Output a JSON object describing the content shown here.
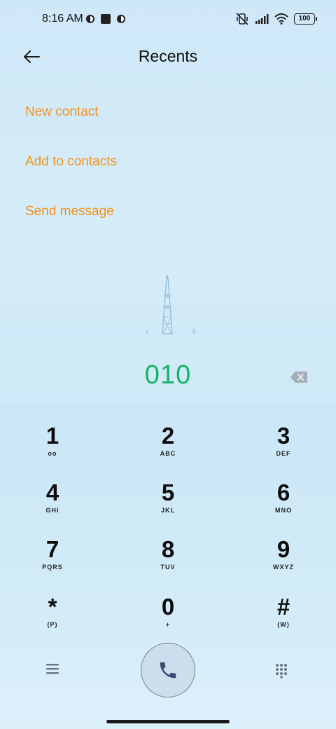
{
  "status_bar": {
    "time": "8:16 AM",
    "battery": "100"
  },
  "header": {
    "title": "Recents"
  },
  "menu": {
    "new_contact": "New contact",
    "add_to_contacts": "Add to contacts",
    "send_message": "Send message"
  },
  "dialer": {
    "number": "010"
  },
  "keypad": {
    "keys": [
      {
        "digit": "1",
        "letters": "ᴏᴏ"
      },
      {
        "digit": "2",
        "letters": "ABC"
      },
      {
        "digit": "3",
        "letters": "DEF"
      },
      {
        "digit": "4",
        "letters": "GHI"
      },
      {
        "digit": "5",
        "letters": "JKL"
      },
      {
        "digit": "6",
        "letters": "MNO"
      },
      {
        "digit": "7",
        "letters": "PQRS"
      },
      {
        "digit": "8",
        "letters": "TUV"
      },
      {
        "digit": "9",
        "letters": "WXYZ"
      },
      {
        "digit": "*",
        "letters": "(P)"
      },
      {
        "digit": "0",
        "letters": "+"
      },
      {
        "digit": "#",
        "letters": "(W)"
      }
    ]
  },
  "colors": {
    "accent": "#f2931c",
    "number": "#13b563"
  }
}
